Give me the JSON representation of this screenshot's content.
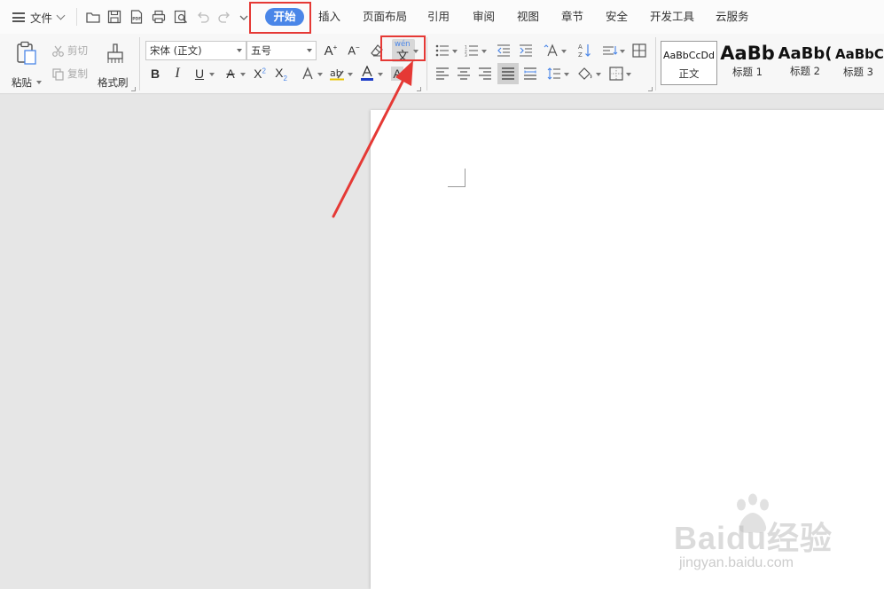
{
  "menubar": {
    "file_label": "文件",
    "tabs": [
      {
        "label": "开始",
        "active": true
      },
      {
        "label": "插入"
      },
      {
        "label": "页面布局"
      },
      {
        "label": "引用"
      },
      {
        "label": "审阅"
      },
      {
        "label": "视图"
      },
      {
        "label": "章节"
      },
      {
        "label": "安全"
      },
      {
        "label": "开发工具"
      },
      {
        "label": "云服务"
      }
    ]
  },
  "ribbon": {
    "paste_label": "粘贴",
    "cut_label": "剪切",
    "copy_label": "复制",
    "format_painter_label": "格式刷",
    "font_name": "宋体 (正文)",
    "font_size": "五号",
    "phonetic_guide": {
      "pinyin": "wén",
      "char": "文"
    },
    "styles": [
      {
        "sample": "AaBbCcDd",
        "name": "正文"
      },
      {
        "sample": "AaBb",
        "name": "标题 1"
      },
      {
        "sample": "AaBb(",
        "name": "标题 2"
      },
      {
        "sample": "AaBbC",
        "name": "标题 3"
      }
    ]
  },
  "watermark": {
    "main": "Baidu经验",
    "url": "jingyan.baidu.com"
  },
  "colors": {
    "accent": "#4a86e8",
    "annotation_red": "#e53935"
  }
}
